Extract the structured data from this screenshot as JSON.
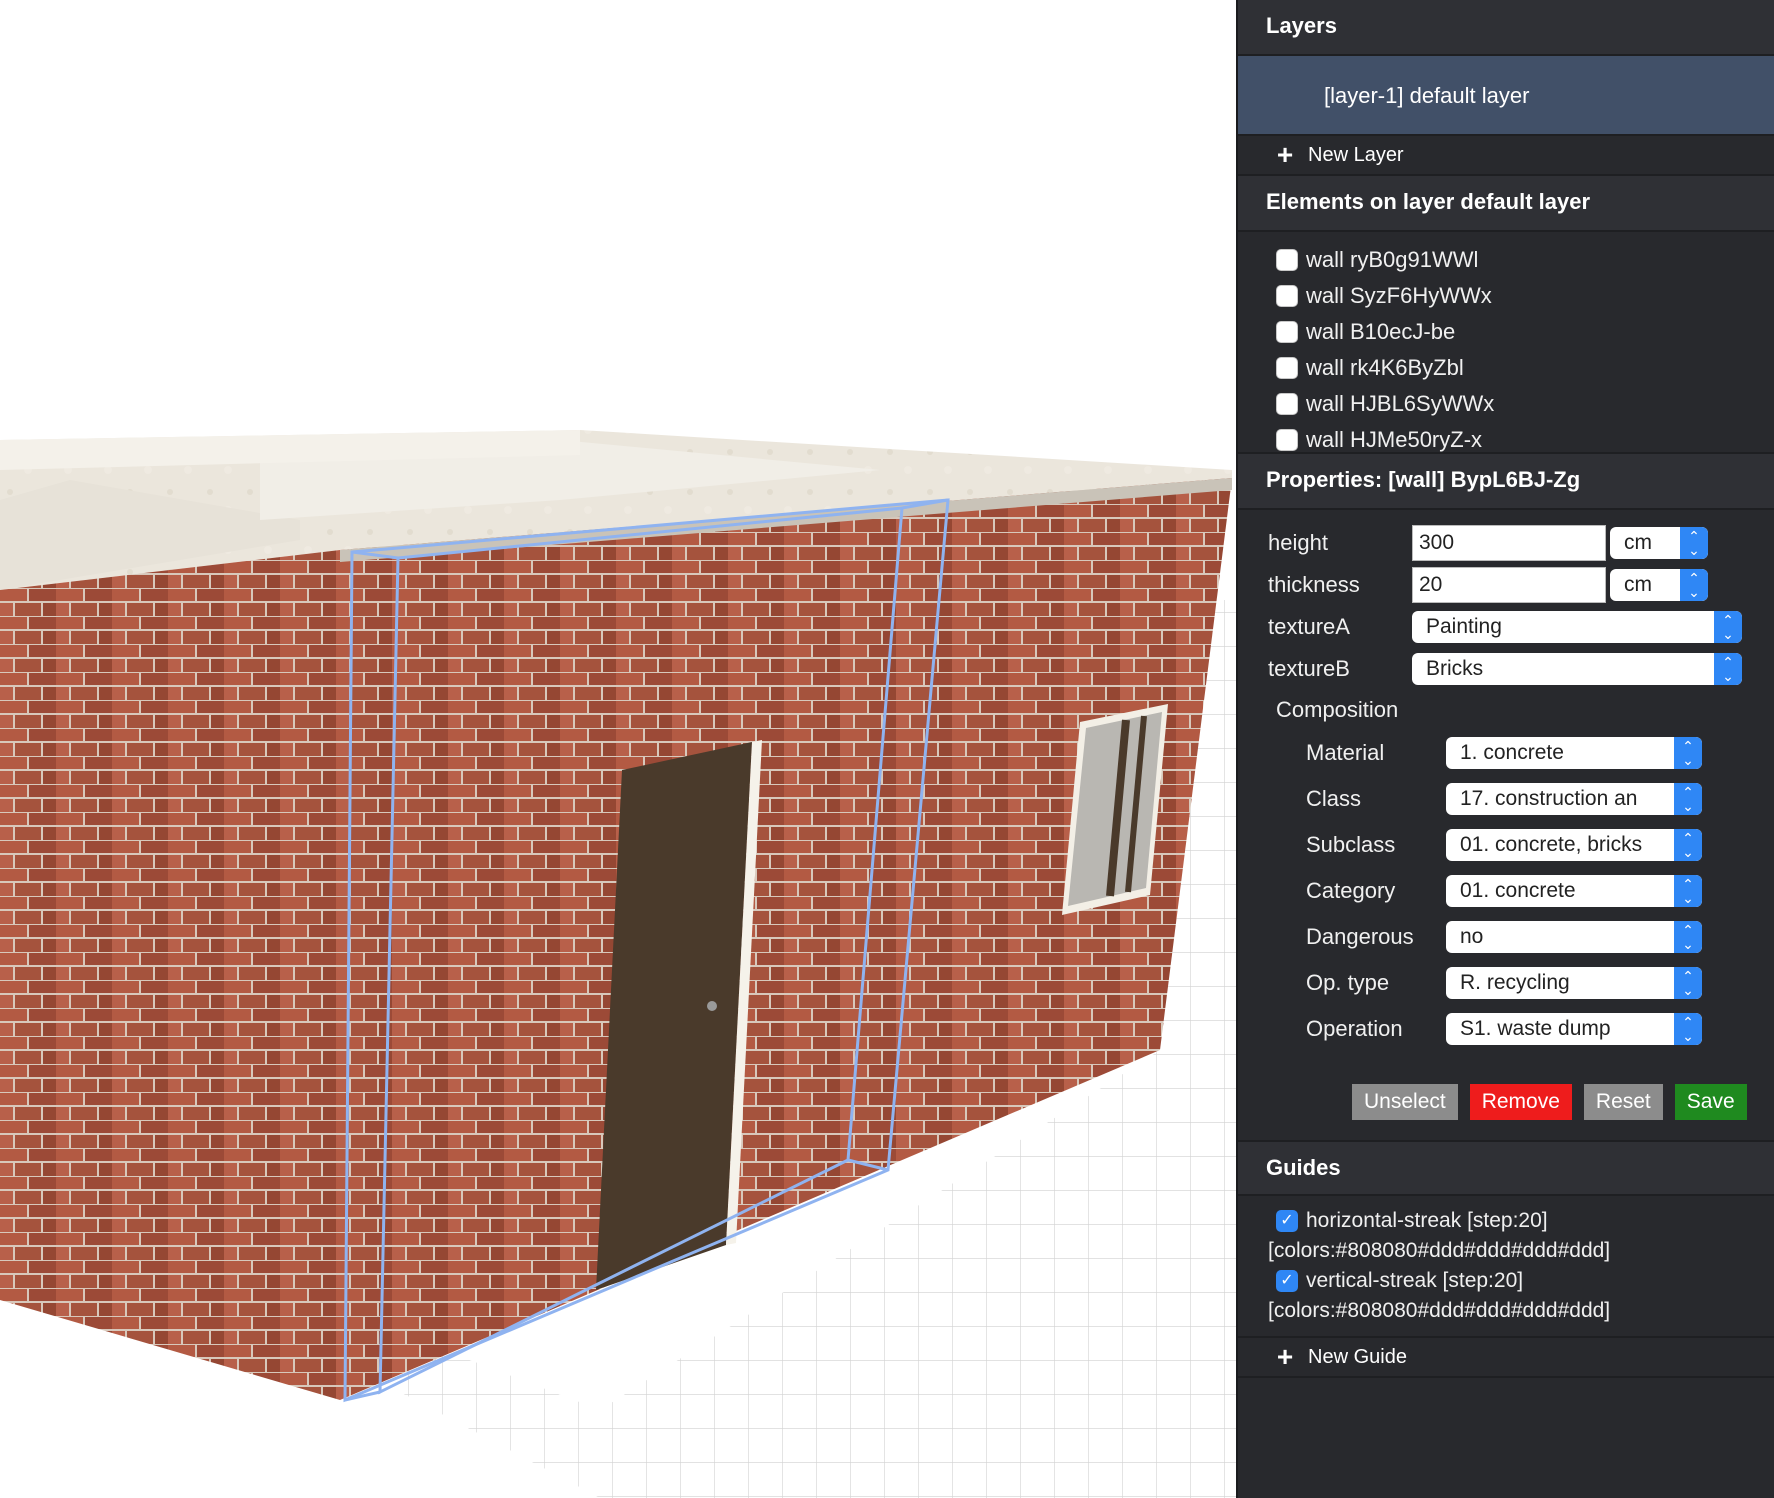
{
  "layers": {
    "header": "Layers",
    "items": [
      {
        "label": "[layer-1] default layer"
      }
    ],
    "new_layer_label": "New Layer"
  },
  "elements": {
    "header": "Elements on layer default layer",
    "items": [
      {
        "label": "wall ryB0g91WWl",
        "checked": false
      },
      {
        "label": "wall SyzF6HyWWx",
        "checked": false
      },
      {
        "label": "wall B10ecJ-be",
        "checked": false
      },
      {
        "label": "wall rk4K6ByZbl",
        "checked": false
      },
      {
        "label": "wall HJBL6SyWWx",
        "checked": false
      },
      {
        "label": "wall HJMe50ryZ-x",
        "checked": false
      }
    ]
  },
  "properties": {
    "header": "Properties: [wall] BypL6BJ-Zg",
    "height": {
      "label": "height",
      "value": "300",
      "unit": "cm"
    },
    "thickness": {
      "label": "thickness",
      "value": "20",
      "unit": "cm"
    },
    "textureA": {
      "label": "textureA",
      "value": "Painting"
    },
    "textureB": {
      "label": "textureB",
      "value": "Bricks"
    },
    "composition": {
      "title": "Composition",
      "rows": [
        {
          "label": "Material",
          "value": "1. concrete"
        },
        {
          "label": "Class",
          "value": "17. construction an"
        },
        {
          "label": "Subclass",
          "value": "01. concrete, bricks"
        },
        {
          "label": "Category",
          "value": "01. concrete"
        },
        {
          "label": "Dangerous",
          "value": "no"
        },
        {
          "label": "Op. type",
          "value": "R. recycling"
        },
        {
          "label": "Operation",
          "value": "S1. waste dump"
        }
      ]
    },
    "buttons": {
      "unselect": "Unselect",
      "remove": "Remove",
      "reset": "Reset",
      "save": "Save"
    }
  },
  "guides": {
    "header": "Guides",
    "items": [
      {
        "name": "horizontal-streak [step:20]",
        "colors": "[colors:#808080#ddd#ddd#ddd#ddd]",
        "checked": true
      },
      {
        "name": "vertical-streak [step:20]",
        "colors": "[colors:#808080#ddd#ddd#ddd#ddd]",
        "checked": true
      }
    ],
    "new_guide_label": "New Guide"
  },
  "colors": {
    "sidebar_bg": "#28292d",
    "selected_layer": "#415068",
    "accent_blue": "#2f87f5",
    "remove_red": "#ee1c1c",
    "save_green": "#1f8a1f",
    "brick": "#a8513c",
    "selection_outline": "#8fb3f0"
  }
}
